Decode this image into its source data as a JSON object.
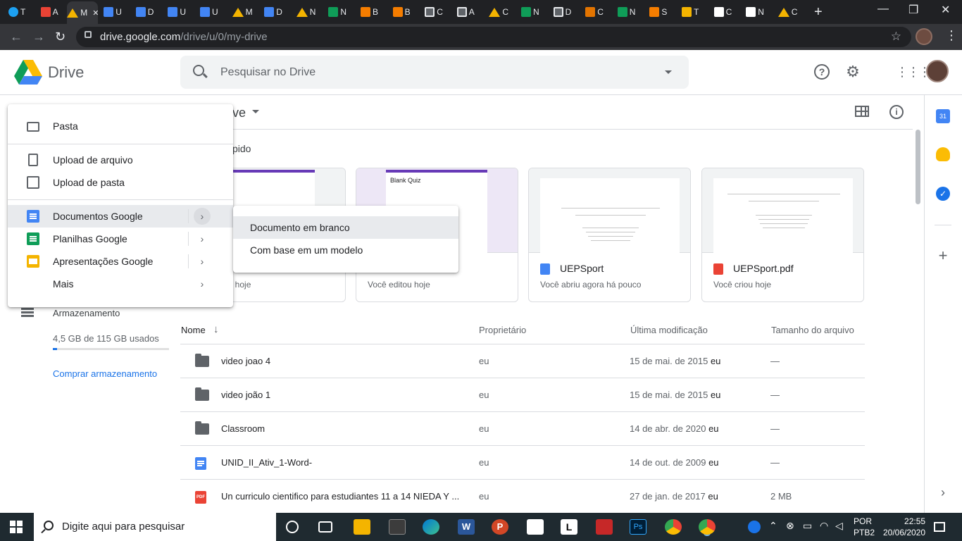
{
  "browser": {
    "tabs": [
      {
        "icon": "twitter-icon",
        "letter": "T"
      },
      {
        "icon": "gmail-icon",
        "letter": "A"
      },
      {
        "icon": "drive-icon",
        "letter": "M",
        "active": true
      },
      {
        "icon": "docs-icon",
        "letter": "U"
      },
      {
        "icon": "docs-icon",
        "letter": "D"
      },
      {
        "icon": "docs-icon",
        "letter": "U"
      },
      {
        "icon": "docs-icon",
        "letter": "U"
      },
      {
        "icon": "drive-icon",
        "letter": "M"
      },
      {
        "icon": "docs-icon",
        "letter": "D"
      },
      {
        "icon": "drive-icon",
        "letter": "N"
      },
      {
        "icon": "sheets-icon",
        "letter": "N"
      },
      {
        "icon": "blogger-icon",
        "letter": "B"
      },
      {
        "icon": "blogger-icon",
        "letter": "B"
      },
      {
        "icon": "classroom-icon",
        "letter": "C"
      },
      {
        "icon": "classroom-icon",
        "letter": "A"
      },
      {
        "icon": "drive-icon",
        "letter": "C"
      },
      {
        "icon": "sheets-icon",
        "letter": "N"
      },
      {
        "icon": "classroom-icon",
        "letter": "D"
      },
      {
        "icon": "mendeley-icon",
        "letter": "C"
      },
      {
        "icon": "sheets-icon",
        "letter": "N"
      },
      {
        "icon": "blogger-icon",
        "letter": "S"
      },
      {
        "icon": "slides-icon",
        "letter": "T"
      },
      {
        "icon": "amazon-icon",
        "letter": "C"
      },
      {
        "icon": "amazon-icon",
        "letter": "N"
      },
      {
        "icon": "drive-icon",
        "letter": "C"
      }
    ],
    "url_host": "drive.google.com",
    "url_path": "/drive/u/0/my-drive"
  },
  "header": {
    "brand": "Drive",
    "search_placeholder": "Pesquisar no Drive"
  },
  "breadcrumb": {
    "partial": "ve"
  },
  "quick_access": {
    "label": "pido",
    "cards": [
      {
        "name": "",
        "sub": "ou hoje",
        "thumb": "quiz-purple"
      },
      {
        "name": "",
        "sub": "Você editou hoje",
        "thumb": "Blank Quiz"
      },
      {
        "name": "UEPSport",
        "sub": "Você abriu agora há pouco",
        "type": "doc"
      },
      {
        "name": "UEPSport.pdf",
        "sub": "Você criou hoje",
        "type": "pdf"
      }
    ]
  },
  "sidebar": {
    "storage_label": "Armazenamento",
    "storage_used": "4,5 GB de 115 GB usados",
    "storage_fraction": 0.039,
    "buy_label": "Comprar armazenamento"
  },
  "table": {
    "col_name": "Nome",
    "col_owner": "Proprietário",
    "col_modified": "Última modificação",
    "col_size": "Tamanho do arquivo",
    "rows": [
      {
        "type": "folder",
        "name": "video joao 4",
        "owner": "eu",
        "modified": "15 de mai. de 2015",
        "by": "eu",
        "size": "—"
      },
      {
        "type": "folder",
        "name": "video joão 1",
        "owner": "eu",
        "modified": "15 de mai. de 2015",
        "by": "eu",
        "size": "—"
      },
      {
        "type": "folder",
        "name": "Classroom",
        "owner": "eu",
        "modified": "14 de abr. de 2020",
        "by": "eu",
        "size": "—"
      },
      {
        "type": "doc",
        "name": "UNID_II_Ativ_1-Word-",
        "owner": "eu",
        "modified": "14 de out. de 2009",
        "by": "eu",
        "size": "—"
      },
      {
        "type": "pdf",
        "name": "Un curriculo cientifico para estudiantes 11 a 14 NIEDA Y ...",
        "owner": "eu",
        "modified": "27 de jan. de 2017",
        "by": "eu",
        "size": "2 MB"
      }
    ]
  },
  "new_menu": {
    "folder": "Pasta",
    "upload_file": "Upload de arquivo",
    "upload_folder": "Upload de pasta",
    "docs": "Documentos Google",
    "sheets": "Planilhas Google",
    "slides": "Apresentações Google",
    "more": "Mais"
  },
  "docs_submenu": {
    "blank": "Documento em branco",
    "template": "Com base em um modelo"
  },
  "taskbar": {
    "search_placeholder": "Digite aqui para pesquisar",
    "lang1": "POR",
    "lang2": "PTB2",
    "time": "22:55",
    "date": "20/06/2020"
  },
  "colors": {
    "accent": "#1a73e8",
    "docs": "#4285f4",
    "sheets": "#0f9d58",
    "slides": "#f4b400",
    "pdf": "#ea4335"
  }
}
